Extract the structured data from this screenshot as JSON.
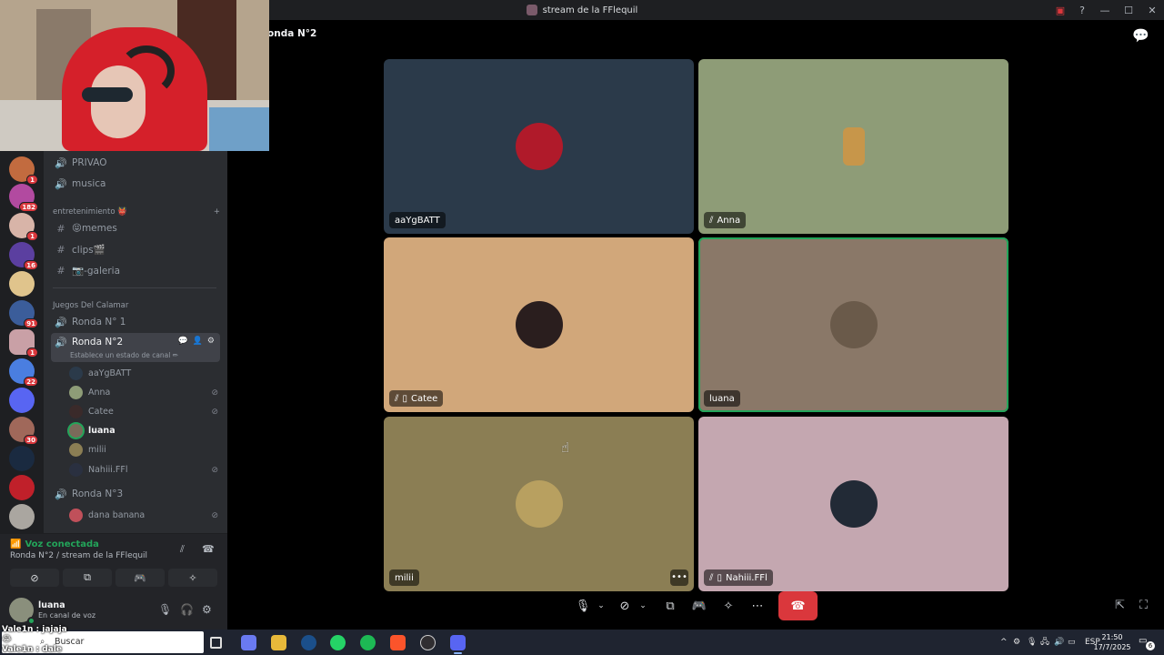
{
  "window": {
    "title": "stream de la FFlequil"
  },
  "stage": {
    "title": "onda N°2"
  },
  "server_badges": [
    "1",
    "182",
    "1",
    "16",
    "91",
    "1",
    "22",
    "30"
  ],
  "channels": {
    "voice_top": [
      "PRIVAO",
      "musica"
    ],
    "category_entretenimiento": "entretenimiento 👹",
    "text_channels": [
      "😝memes",
      "clips🎬",
      "📷-galeria"
    ],
    "category_calamar": "Juegos Del Calamar",
    "ronda1": "Ronda N° 1",
    "ronda2": "Ronda N°2",
    "ronda2_status": "Establece un estado de canal ✏",
    "ronda3": "Ronda N°3",
    "users_ronda2": [
      "aaYgBATT",
      "Anna",
      "Catee",
      "luana",
      "milii",
      "Nahiii.FFl"
    ],
    "users_ronda3": [
      "dana banana"
    ]
  },
  "voice_panel": {
    "status": "Voz conectada",
    "sub": "Ronda N°2 / stream de la FFlequil"
  },
  "user_panel": {
    "name": "luana",
    "sub": "En canal de voz"
  },
  "tiles": [
    {
      "name": "aaYgBATT",
      "bg": "#2b3a4a"
    },
    {
      "name": "Anna",
      "bg": "#8e9c77"
    },
    {
      "name": "Catee",
      "bg": "#d1a77a"
    },
    {
      "name": "luana",
      "bg": "#8a7868"
    },
    {
      "name": "milii",
      "bg": "#8b7e54"
    },
    {
      "name": "Nahiii.FFl",
      "bg": "#c4a7b0"
    }
  ],
  "taskbar": {
    "search_placeholder": "Buscar",
    "language": "ESP",
    "time": "21:50",
    "date": "17/7/2025",
    "notifications": "6"
  },
  "chat_overlay": {
    "line1": "Vale1n : jajaja 😂",
    "line2": "Vale1n : dale"
  },
  "colors": {
    "speaking": "#23a55a",
    "hangup": "#da373c",
    "sidebar": "#2b2d31",
    "rail": "#1e1f22"
  }
}
